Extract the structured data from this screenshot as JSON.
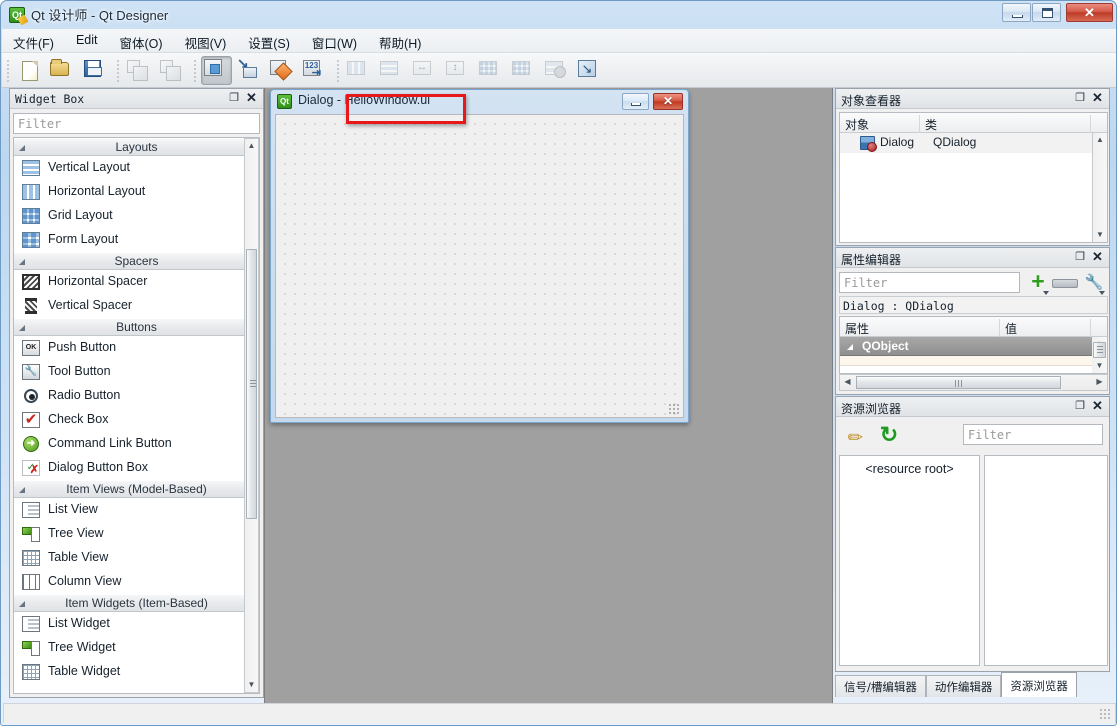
{
  "window": {
    "title": "Qt 设计师 - Qt Designer",
    "app_icon": "qt-logo-icon",
    "controls": {
      "minimize": "minimize-icon",
      "maximize": "maximize-icon",
      "close": "✕"
    }
  },
  "menubar": {
    "items": [
      {
        "label": "文件(F)"
      },
      {
        "label": "Edit"
      },
      {
        "label": "窗体(O)"
      },
      {
        "label": "视图(V)"
      },
      {
        "label": "设置(S)"
      },
      {
        "label": "窗口(W)"
      },
      {
        "label": "帮助(H)"
      }
    ]
  },
  "toolbar": {
    "groups": [
      {
        "buttons": [
          {
            "name": "new-form-button",
            "icon": "new-file-icon",
            "state": "enabled"
          },
          {
            "name": "open-form-button",
            "icon": "open-folder-icon",
            "state": "enabled"
          },
          {
            "name": "save-form-button",
            "icon": "floppy-disk-icon",
            "state": "enabled"
          }
        ]
      },
      {
        "buttons": [
          {
            "name": "undo-button",
            "icon": "copy-pair-icon",
            "state": "disabled"
          },
          {
            "name": "redo-button",
            "icon": "copy-pair-icon",
            "state": "disabled"
          }
        ]
      },
      {
        "buttons": [
          {
            "name": "edit-widgets-button",
            "icon": "edit-widgets-icon",
            "state": "active"
          },
          {
            "name": "edit-signals-slots-button",
            "icon": "signal-slot-icon",
            "state": "enabled"
          },
          {
            "name": "edit-buddies-button",
            "icon": "buddy-icon",
            "state": "enabled"
          },
          {
            "name": "edit-tab-order-button",
            "icon": "tab-order-icon",
            "state": "enabled"
          }
        ]
      },
      {
        "buttons": [
          {
            "name": "layout-horizontally-button",
            "icon": "horizontal-layout-icon",
            "state": "disabled"
          },
          {
            "name": "layout-vertically-button",
            "icon": "vertical-layout-icon",
            "state": "disabled"
          },
          {
            "name": "layout-splitter-horizontal-button",
            "icon": "horizontal-splitter-icon",
            "state": "disabled"
          },
          {
            "name": "layout-splitter-vertical-button",
            "icon": "vertical-splitter-icon",
            "state": "disabled"
          },
          {
            "name": "layout-grid-button",
            "icon": "grid-layout-icon",
            "state": "disabled"
          },
          {
            "name": "layout-form-button",
            "icon": "form-layout-icon",
            "state": "disabled"
          },
          {
            "name": "break-layout-button",
            "icon": "break-layout-icon",
            "state": "disabled"
          },
          {
            "name": "adjust-size-button",
            "icon": "adjust-size-icon",
            "state": "enabled"
          }
        ]
      }
    ]
  },
  "widget_box": {
    "title": "Widget Box",
    "filter_placeholder": "Filter",
    "groups": [
      {
        "label": "Layouts",
        "items": [
          {
            "label": "Vertical Layout",
            "icon": "vertical-layout-icon"
          },
          {
            "label": "Horizontal Layout",
            "icon": "horizontal-layout-icon"
          },
          {
            "label": "Grid Layout",
            "icon": "grid-layout-icon"
          },
          {
            "label": "Form Layout",
            "icon": "form-layout-icon"
          }
        ]
      },
      {
        "label": "Spacers",
        "items": [
          {
            "label": "Horizontal Spacer",
            "icon": "horizontal-spacer-icon"
          },
          {
            "label": "Vertical Spacer",
            "icon": "vertical-spacer-icon"
          }
        ]
      },
      {
        "label": "Buttons",
        "items": [
          {
            "label": "Push Button",
            "icon": "push-button-icon"
          },
          {
            "label": "Tool Button",
            "icon": "tool-button-icon"
          },
          {
            "label": "Radio Button",
            "icon": "radio-button-icon"
          },
          {
            "label": "Check Box",
            "icon": "check-box-icon"
          },
          {
            "label": "Command Link Button",
            "icon": "command-link-icon"
          },
          {
            "label": "Dialog Button Box",
            "icon": "dialog-button-box-icon"
          }
        ]
      },
      {
        "label": "Item Views (Model-Based)",
        "items": [
          {
            "label": "List View",
            "icon": "list-view-icon"
          },
          {
            "label": "Tree View",
            "icon": "tree-view-icon"
          },
          {
            "label": "Table View",
            "icon": "table-view-icon"
          },
          {
            "label": "Column View",
            "icon": "column-view-icon"
          }
        ]
      },
      {
        "label": "Item Widgets (Item-Based)",
        "items": [
          {
            "label": "List Widget",
            "icon": "list-widget-icon"
          },
          {
            "label": "Tree Widget",
            "icon": "tree-widget-icon"
          },
          {
            "label": "Table Widget",
            "icon": "table-widget-icon"
          }
        ]
      }
    ]
  },
  "form_window": {
    "title": "Dialog - HelloWindow.ui",
    "icon": "qt-form-icon",
    "minimize": "minimize-icon",
    "close": "✕",
    "annotation_color": "#e8181a"
  },
  "object_inspector": {
    "title": "对象查看器",
    "columns": [
      "对象",
      "类"
    ],
    "rows": [
      {
        "object": "Dialog",
        "class": "QDialog",
        "icon": "dialog-object-icon"
      }
    ]
  },
  "property_editor": {
    "title": "属性编辑器",
    "filter_placeholder": "Filter",
    "object_line": "Dialog : QDialog",
    "columns": [
      "属性",
      "值"
    ],
    "groups": [
      {
        "label": "QObject"
      }
    ],
    "tools": {
      "add": "add-property-icon",
      "remove": "remove-property-icon",
      "configure": "configure-icon"
    }
  },
  "resource_browser": {
    "title": "资源浏览器",
    "filter_placeholder": "Filter",
    "edit_icon": "edit-pencil-icon",
    "reload_icon": "reload-icon",
    "root_label": "<resource root>"
  },
  "dock_tabs": {
    "items": [
      {
        "label": "信号/槽编辑器",
        "selected": false
      },
      {
        "label": "动作编辑器",
        "selected": false
      },
      {
        "label": "资源浏览器",
        "selected": true
      }
    ]
  },
  "statusbar": {
    "text": ""
  }
}
